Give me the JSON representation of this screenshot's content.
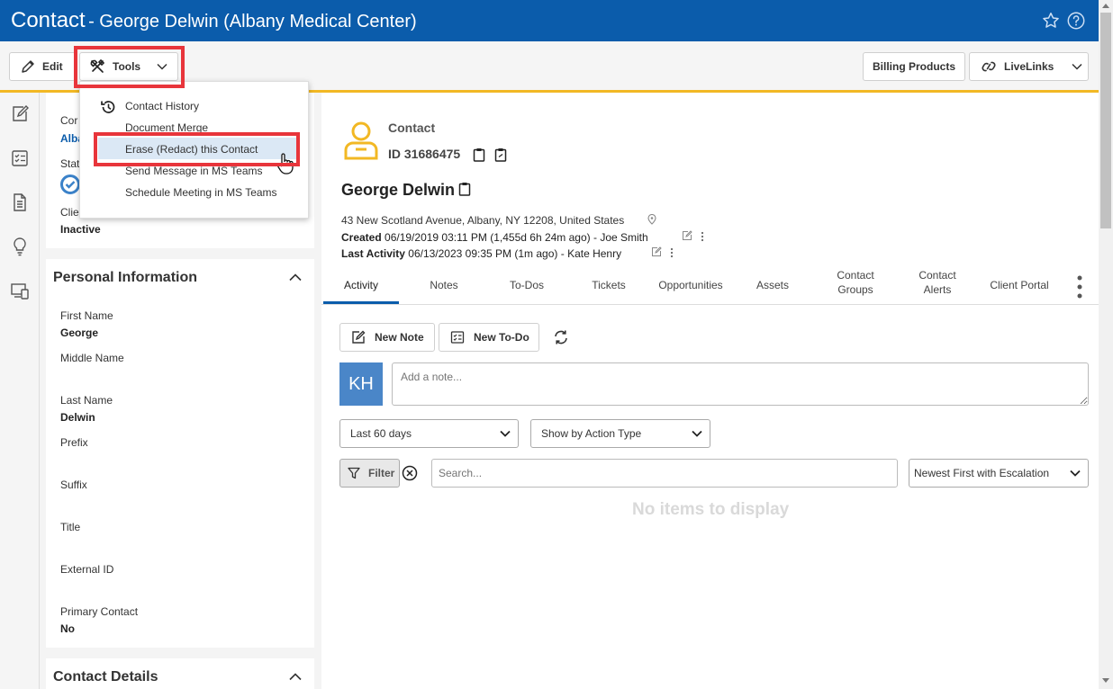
{
  "header": {
    "title": "Contact",
    "subtitle": "- George Delwin (Albany Medical Center)"
  },
  "toolbar": {
    "edit_label": "Edit",
    "tools_label": "Tools",
    "billing_label": "Billing Products",
    "livelinks_label": "LiveLinks"
  },
  "tools_menu": {
    "items": [
      "Contact History",
      "Document Merge",
      "Erase (Redact) this Contact",
      "Send Message in MS Teams",
      "Schedule Meeting in MS Teams"
    ]
  },
  "summary_card": {
    "company_label_partial": "Cor",
    "company_value_partial": "Alba",
    "status_label_partial": "Stat",
    "client_label_partial": "Clie",
    "client_value": "Inactive"
  },
  "personal_info": {
    "title": "Personal Information",
    "fields": [
      {
        "label": "First Name",
        "value": "George"
      },
      {
        "label": "Middle Name",
        "value": ""
      },
      {
        "label": "Last Name",
        "value": "Delwin"
      },
      {
        "label": "Prefix",
        "value": ""
      },
      {
        "label": "Suffix",
        "value": ""
      },
      {
        "label": "Title",
        "value": ""
      },
      {
        "label": "External ID",
        "value": ""
      },
      {
        "label": "Primary Contact",
        "value": "No"
      }
    ]
  },
  "contact_details": {
    "title": "Contact Details"
  },
  "record": {
    "type": "Contact",
    "id": "ID 31686475",
    "name": "George Delwin",
    "address": "43 New Scotland Avenue, Albany, NY 12208, United States",
    "created_label": "Created",
    "created_value": "06/19/2019 03:11 PM (1,455d 6h 24m ago)",
    "created_by": "Joe Smith",
    "activity_label": "Last Activity",
    "activity_value": "06/13/2023 09:35 PM (1m ago)",
    "activity_by": "Kate Henry",
    "separator": "-"
  },
  "tabs": [
    {
      "line1": "Activity",
      "line2": ""
    },
    {
      "line1": "Notes",
      "line2": ""
    },
    {
      "line1": "To-Dos",
      "line2": ""
    },
    {
      "line1": "Tickets",
      "line2": ""
    },
    {
      "line1": "Opportunities",
      "line2": ""
    },
    {
      "line1": "Assets",
      "line2": ""
    },
    {
      "line1": "Contact",
      "line2": "Groups"
    },
    {
      "line1": "Contact",
      "line2": "Alerts"
    },
    {
      "line1": "Client Portal",
      "line2": ""
    }
  ],
  "activity": {
    "new_note_label": "New Note",
    "new_todo_label": "New To-Do",
    "avatar_initials": "KH",
    "note_placeholder": "Add a note...",
    "range_value": "Last 60 days",
    "action_type_value": "Show by Action Type",
    "filter_label": "Filter",
    "search_placeholder": "Search...",
    "sort_value": "Newest First with Escalation",
    "empty_text": "No items to display"
  },
  "colors": {
    "header_blue": "#0b5cab",
    "accent_yellow": "#f2b824",
    "highlight_red": "#e8353b",
    "avatar_blue": "#4a86c8"
  }
}
